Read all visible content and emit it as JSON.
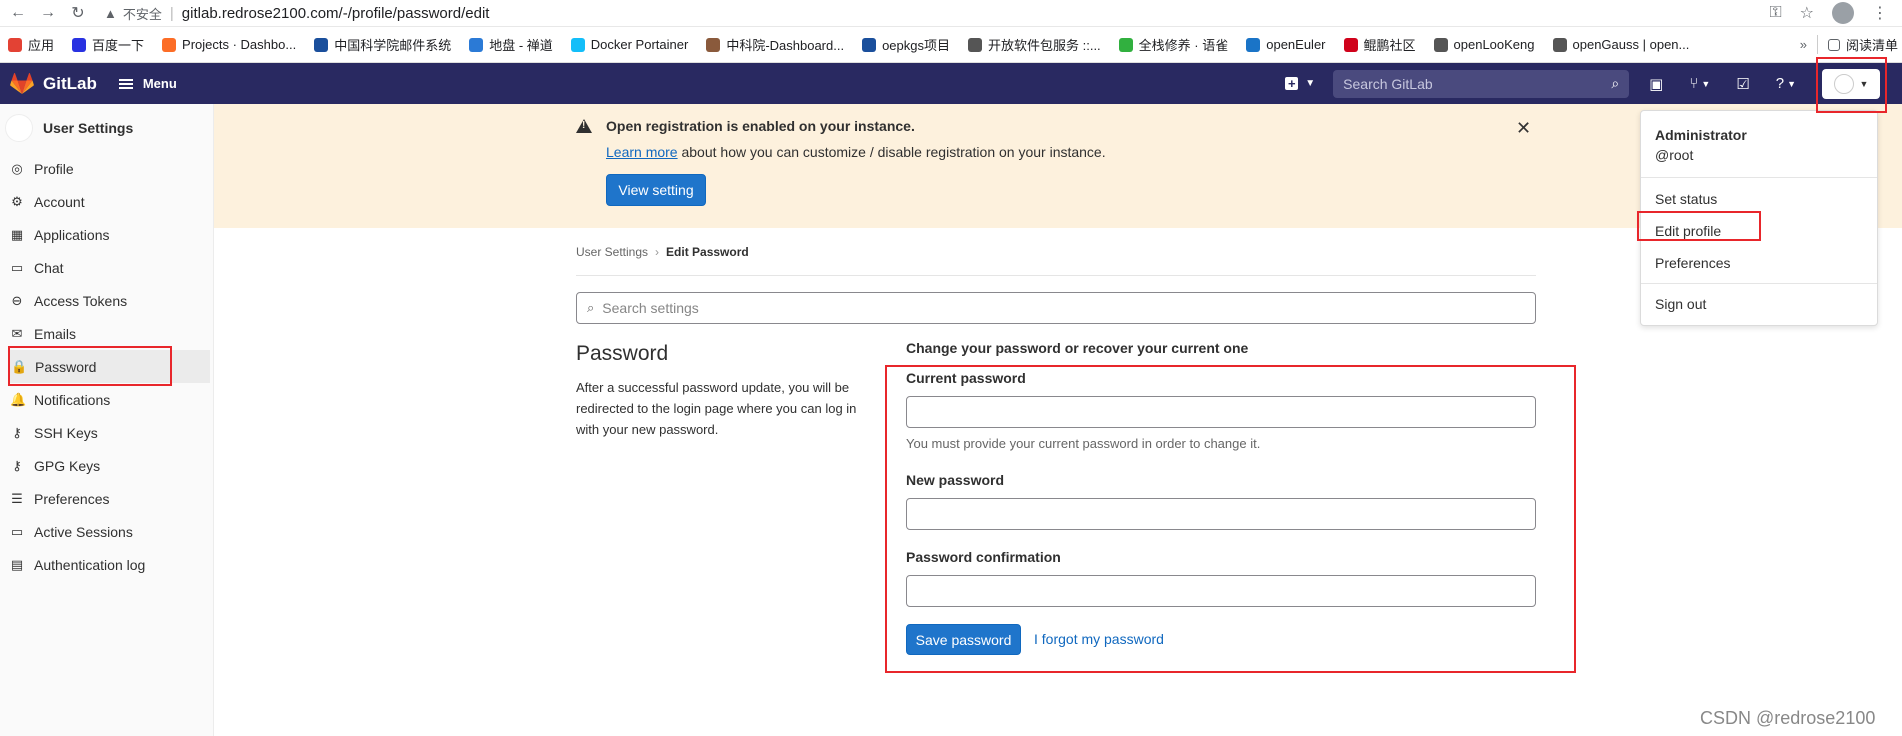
{
  "browser": {
    "insecure_label": "不安全",
    "url": "gitlab.redrose2100.com/-/profile/password/edit"
  },
  "bookmarks": [
    {
      "label": "应用",
      "color": "#e34234"
    },
    {
      "label": "百度一下",
      "color": "#2932e1"
    },
    {
      "label": "Projects · Dashbo...",
      "color": "#fc6d26"
    },
    {
      "label": "中国科学院邮件系统",
      "color": "#1a4f9c"
    },
    {
      "label": "地盘 - 禅道",
      "color": "#2b7ad6"
    },
    {
      "label": "Docker Portainer",
      "color": "#13bef9"
    },
    {
      "label": "中科院-Dashboard...",
      "color": "#8a5a3c"
    },
    {
      "label": "oepkgs项目",
      "color": "#1a4f9c"
    },
    {
      "label": "开放软件包服务 ::...",
      "color": "#555555"
    },
    {
      "label": "全栈修养 · 语雀",
      "color": "#31b03f"
    },
    {
      "label": "openEuler",
      "color": "#1a74c7"
    },
    {
      "label": "鲲鹏社区",
      "color": "#d0021b"
    },
    {
      "label": "openLooKeng",
      "color": "#555555"
    },
    {
      "label": "openGauss | open...",
      "color": "#555555"
    }
  ],
  "bookmarks_more": "»",
  "bookmarks_reading": "阅读清单",
  "gitlab": {
    "brand": "GitLab",
    "menu_label": "Menu",
    "search_placeholder": "Search GitLab"
  },
  "sidebar": {
    "title": "User Settings",
    "items": [
      {
        "label": "Profile",
        "icon": "◎"
      },
      {
        "label": "Account",
        "icon": "⚙"
      },
      {
        "label": "Applications",
        "icon": "▦"
      },
      {
        "label": "Chat",
        "icon": "▭"
      },
      {
        "label": "Access Tokens",
        "icon": "⊖"
      },
      {
        "label": "Emails",
        "icon": "✉"
      },
      {
        "label": "Password",
        "icon": "🔒"
      },
      {
        "label": "Notifications",
        "icon": "🔔"
      },
      {
        "label": "SSH Keys",
        "icon": "⚷"
      },
      {
        "label": "GPG Keys",
        "icon": "⚷"
      },
      {
        "label": "Preferences",
        "icon": "☰"
      },
      {
        "label": "Active Sessions",
        "icon": "▭"
      },
      {
        "label": "Authentication log",
        "icon": "▤"
      }
    ]
  },
  "banner": {
    "title": "Open registration is enabled on your instance.",
    "link": "Learn more",
    "text": " about how you can customize / disable registration on your instance.",
    "button": "View setting"
  },
  "breadcrumb": {
    "parent": "User Settings",
    "current": "Edit Password"
  },
  "search_settings_placeholder": "Search settings",
  "password_section": {
    "title": "Password",
    "description": "After a successful password update, you will be redirected to the login page where you can log in with your new password."
  },
  "form": {
    "heading": "Change your password or recover your current one",
    "current_label": "Current password",
    "current_help": "You must provide your current password in order to change it.",
    "new_label": "New password",
    "confirm_label": "Password confirmation",
    "save_button": "Save password",
    "forgot_link": "I forgot my password"
  },
  "dropdown": {
    "name": "Administrator",
    "username": "@root",
    "items": [
      "Set status",
      "Edit profile",
      "Preferences",
      "Sign out"
    ]
  },
  "watermark": "CSDN @redrose2100"
}
